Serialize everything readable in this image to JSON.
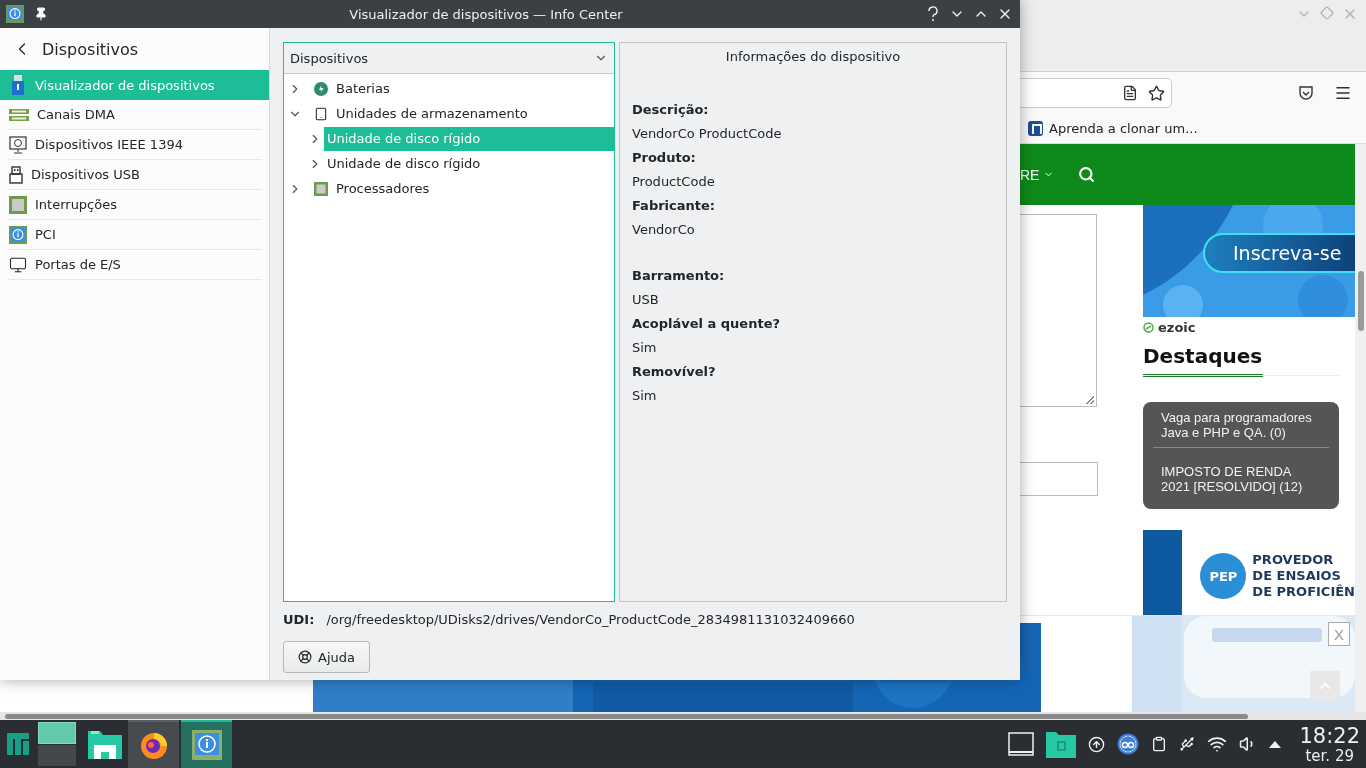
{
  "window": {
    "title": "Visualizador de dispositivos — Info Center"
  },
  "sidebar": {
    "title": "Dispositivos",
    "items": [
      {
        "label": "Visualizador de dispositivos",
        "selected": true
      },
      {
        "label": "Canais DMA",
        "selected": false
      },
      {
        "label": "Dispositivos IEEE 1394",
        "selected": false
      },
      {
        "label": "Dispositivos USB",
        "selected": false
      },
      {
        "label": "Interrupções",
        "selected": false
      },
      {
        "label": "PCI",
        "selected": false
      },
      {
        "label": "Portas de E/S",
        "selected": false
      }
    ]
  },
  "device_tree": {
    "header": "Dispositivos",
    "items": [
      {
        "label": "Baterias",
        "expanded": false,
        "selected": false
      },
      {
        "label": "Unidades de armazenamento",
        "expanded": true,
        "selected": false,
        "children": [
          {
            "label": "Unidade de disco rígido",
            "expanded": false,
            "selected": true
          },
          {
            "label": "Unidade de disco rígido",
            "expanded": false,
            "selected": false
          }
        ]
      },
      {
        "label": "Processadores",
        "expanded": false,
        "selected": false
      }
    ]
  },
  "device_info": {
    "title": "Informações do dispositivo",
    "groups": [
      [
        {
          "label": "Descrição:",
          "value": "VendorCo ProductCode"
        },
        {
          "label": "Produto:",
          "value": "ProductCode"
        },
        {
          "label": "Fabricante:",
          "value": "VendorCo"
        }
      ],
      [
        {
          "label": "Barramento:",
          "value": "USB"
        },
        {
          "label": "Acoplável a quente?",
          "value": "Sim"
        },
        {
          "label": "Removível?",
          "value": "Sim"
        }
      ]
    ]
  },
  "udi": {
    "label": "UDI:",
    "value": "/org/freedesktop/UDisks2/drives/VendorCo_ProductCode_2834981131032409660"
  },
  "buttons": [
    {
      "label": "Ajuda"
    }
  ],
  "browser": {
    "bookmark": "Aprenda a clonar um...",
    "nav_item": "RE",
    "ad_button": "Inscreva-se",
    "ad_brand": "ezoic",
    "featured": {
      "title": "Destaques",
      "items": [
        "Vaga para programadores Java e PHP e QA. (0)",
        "IMPOSTO DE RENDA 2021 [RESOLVIDO] (12)"
      ]
    },
    "promo": {
      "badge": "PEP",
      "lines": [
        "PROVEDOR",
        "DE ENSAIOS",
        "DE PROFICIÊN"
      ]
    },
    "ad_close": "X"
  },
  "taskbar": {
    "tasks": [
      {
        "highlighted": true,
        "selected": false
      },
      {
        "highlighted": false,
        "selected": true
      }
    ],
    "clock": {
      "time": "18:22",
      "date": "ter. 29"
    }
  }
}
